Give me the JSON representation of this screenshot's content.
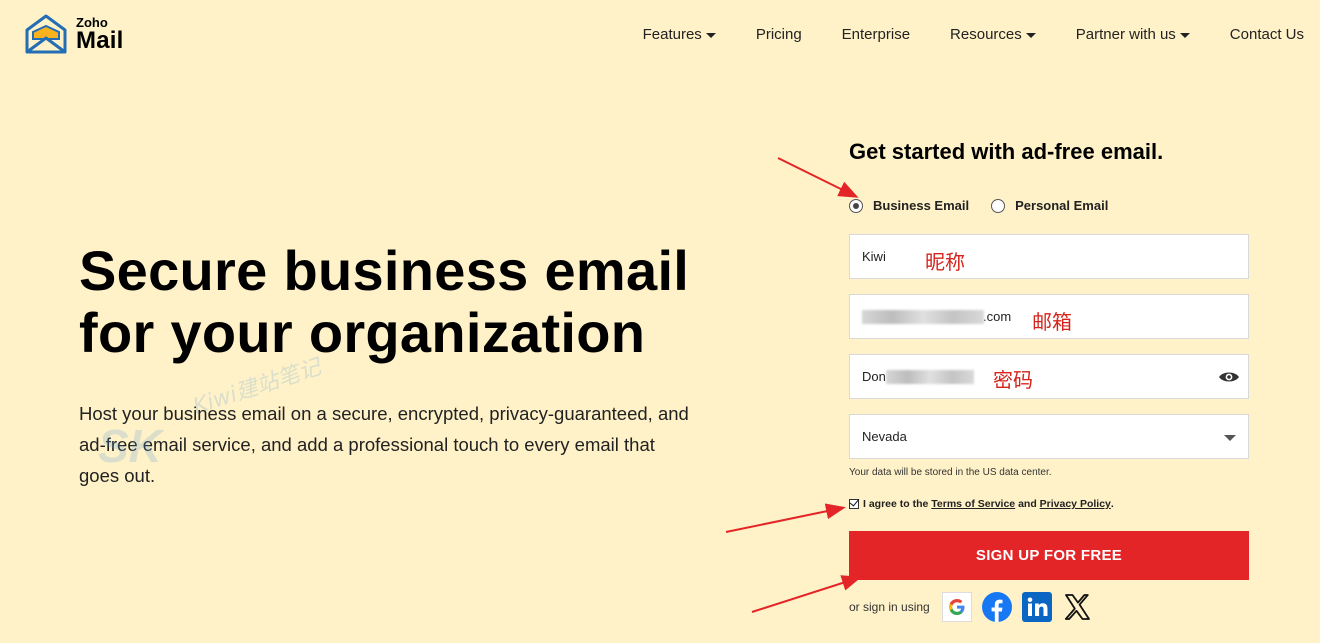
{
  "logo": {
    "brand": "Zoho",
    "product": "Mail"
  },
  "nav": {
    "items": [
      {
        "label": "Features",
        "dropdown": true
      },
      {
        "label": "Pricing",
        "dropdown": false
      },
      {
        "label": "Enterprise",
        "dropdown": false
      },
      {
        "label": "Resources",
        "dropdown": true
      },
      {
        "label": "Partner with us",
        "dropdown": true
      },
      {
        "label": "Contact Us",
        "dropdown": false
      }
    ]
  },
  "hero": {
    "title_line1": "Secure business email",
    "title_line2": "for your organization",
    "description": "Host your business email on a secure, encrypted, privacy-guaranteed, and ad-free email service, and add a professional touch to every email that goes out."
  },
  "watermark": {
    "text": "Kiwi建站笔记",
    "logo": "SK"
  },
  "form": {
    "title": "Get started with ad-free email.",
    "account_type": {
      "options": [
        "Business Email",
        "Personal Email"
      ],
      "selected": "Business Email"
    },
    "name_field": {
      "value": "Kiwi",
      "annotation": "昵称"
    },
    "email_field": {
      "visible_suffix": ".com",
      "annotation": "邮箱"
    },
    "password_field": {
      "visible_prefix": "Don",
      "annotation": "密码"
    },
    "region_select": {
      "value": "Nevada"
    },
    "datacenter_note": "Your data will be stored in the US data center.",
    "agree": {
      "prefix": "I agree to the",
      "terms": "Terms of Service",
      "and": "and",
      "privacy": "Privacy Policy",
      "suffix": ".",
      "checked": true
    },
    "signup_label": "SIGN UP FOR FREE",
    "signin_label": "or sign in using"
  },
  "colors": {
    "background": "#fff2c8",
    "accent_red": "#e42527",
    "annotation_red": "#d6241c",
    "logo_blue": "#226db4",
    "logo_yellow": "#f9b21d"
  }
}
